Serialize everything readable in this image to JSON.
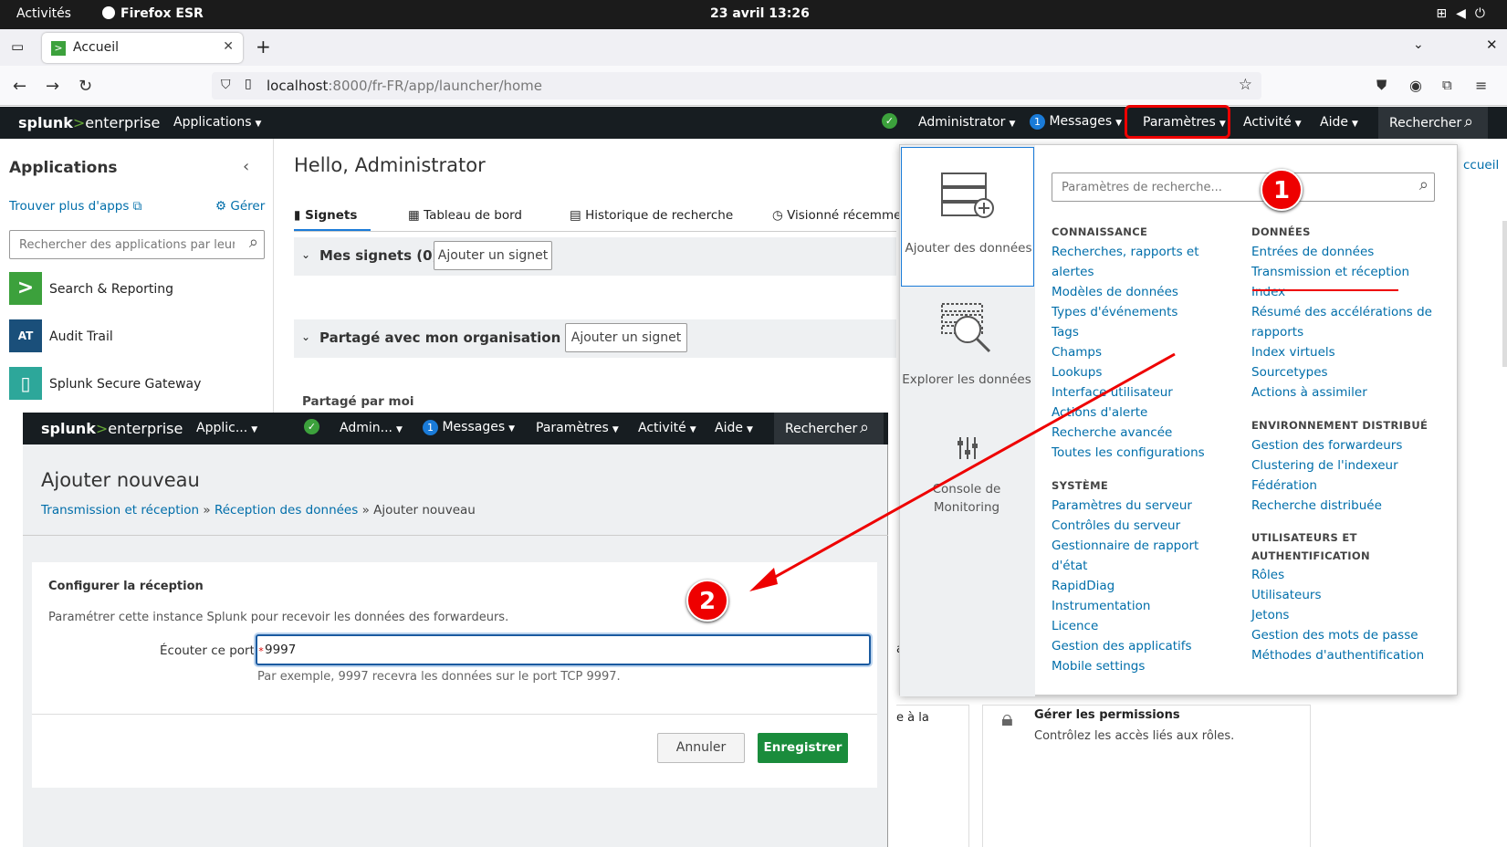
{
  "gnome": {
    "activities": "Activités",
    "app": "Firefox ESR",
    "clock": "23 avril  13:26"
  },
  "browser": {
    "tab_title": "Accueil",
    "url_host": "localhost",
    "url_path": ":8000/fr-FR/app/launcher/home"
  },
  "splunk": {
    "logo_a": "splunk",
    "logo_b": ">",
    "logo_c": "enterprise",
    "nav": {
      "applications": "Applications",
      "administrator": "Administrator",
      "messages": "Messages",
      "messages_count": "1",
      "parametres": "Paramètres",
      "activite": "Activité",
      "aide": "Aide",
      "rechercher": "Rechercher"
    }
  },
  "sidebar": {
    "title": "Applications",
    "find_more": "Trouver plus d'apps",
    "manage": "Gérer",
    "search_placeholder": "Rechercher des applications par leur n",
    "apps": [
      {
        "label": "Search & Reporting",
        "icon": ">",
        "color": "#3ca13c"
      },
      {
        "label": "Audit Trail",
        "icon": "AT",
        "color": "#1a4f7a"
      },
      {
        "label": "Splunk Secure Gateway",
        "icon": "▯",
        "color": "#2da79a"
      }
    ]
  },
  "main": {
    "hello": "Hello, Administrator",
    "tabs": [
      "Signets",
      "Tableau de bord",
      "Historique de recherche",
      "Visionné récemme"
    ],
    "bookmarks": "Mes signets (0)",
    "add_bookmark": "Ajouter un signet",
    "shared": "Partagé avec mon organisation (0)",
    "shared_by_me": "Partagé par moi",
    "accueil_link": "ccueil",
    "perm_title": "Gérer les permissions",
    "perm_desc": "Contrôlez les accès liés aux rôles.",
    "frag1": "a",
    "frag2": "e à la"
  },
  "dropdown": {
    "side": [
      {
        "label": "Ajouter des données",
        "icon": "add-data-icon"
      },
      {
        "label": "Explorer les données",
        "icon": "explore-data-icon"
      },
      {
        "label": "Console de Monitoring",
        "icon": "monitoring-icon"
      }
    ],
    "search_placeholder": "Paramètres de recherche...",
    "connaissance": {
      "title": "CONNAISSANCE",
      "items": [
        "Recherches, rapports et alertes",
        "Modèles de données",
        "Types d'événements",
        "Tags",
        "Champs",
        "Lookups",
        "Interface utilisateur",
        "Actions d'alerte",
        "Recherche avancée",
        "Toutes les configurations"
      ]
    },
    "systeme": {
      "title": "SYSTÈME",
      "items": [
        "Paramètres du serveur",
        "Contrôles du serveur",
        "Gestionnaire de rapport d'état",
        "RapidDiag",
        "Instrumentation",
        "Licence",
        "Gestion des applicatifs",
        "Mobile settings"
      ]
    },
    "donnees": {
      "title": "DONNÉES",
      "items": [
        "Entrées de données",
        "Transmission et réception",
        "Index",
        "Résumé des accélérations de rapports",
        "Index virtuels",
        "Sourcetypes",
        "Actions à assimiler"
      ]
    },
    "distribue": {
      "title": "ENVIRONNEMENT DISTRIBUÉ",
      "items": [
        "Gestion des forwardeurs",
        "Clustering de l'indexeur",
        "Fédération",
        "Recherche distribuée"
      ]
    },
    "users": {
      "title1": "UTILISATEURS ET",
      "title2": "AUTHENTIFICATION",
      "items": [
        "Rôles",
        "Utilisateurs",
        "Jetons",
        "Gestion des mots de passe",
        "Méthodes d'authentification"
      ]
    }
  },
  "overlay": {
    "nav": {
      "applications": "Applic...",
      "administrator": "Admin...",
      "messages": "Messages",
      "messages_count": "1",
      "parametres": "Paramètres",
      "activite": "Activité",
      "aide": "Aide",
      "rechercher": "Rechercher"
    },
    "title": "Ajouter nouveau",
    "crumb1": "Transmission et réception",
    "sep": " » ",
    "crumb2": "Réception des données",
    "crumb3": "Ajouter nouveau",
    "section": "Configurer la réception",
    "desc": "Paramétrer cette instance Splunk pour recevoir les données des forwardeurs.",
    "port_label": "Écouter ce port",
    "required": "*",
    "port_value": "9997",
    "hint": "Par exemple, 9997 recevra les données sur le port TCP 9997.",
    "cancel": "Annuler",
    "save": "Enregistrer"
  },
  "annotations": {
    "badge1": "1",
    "badge2": "2",
    "color": "#e00000"
  }
}
